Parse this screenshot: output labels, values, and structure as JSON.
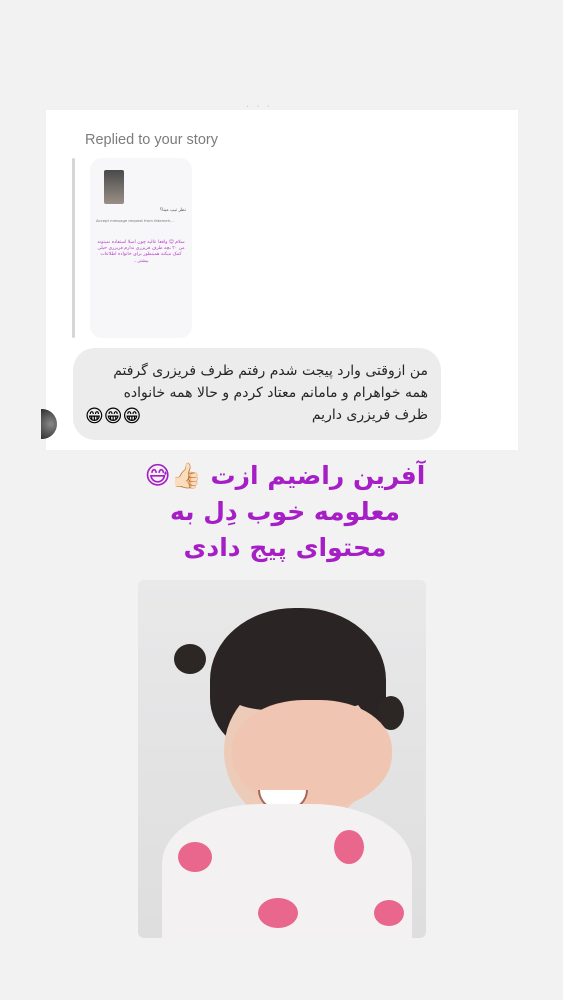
{
  "dm": {
    "replied_label": "Replied to your story",
    "story_preview": {
      "caption": "نظر تیپ مینا؟",
      "meta": "Accept message request from fatemeh...",
      "text": "سلام 😊 واقعا عالیه چون اصلا استفاده نمیتونه من ۲۰ بچه ظرف فریزری ندارم فریزری خیلی کمک میکنه همینطور برای خانواده اطلاعات بیشتر..."
    },
    "message": "من  ازوقتی وارد پیجت شدم رفتم ظرف فریزری گرفتم همه خواهرام و مامانم معتاد کردم و حالا همه خانواده ظرف فریزری داریم",
    "message_emojis": "😁😁😁"
  },
  "overlay": {
    "line1": "آفرین راضیم ازت 👍🏻😅",
    "line2": "معلومه خوب دِل به",
    "line3": "محتوای پیج دادی"
  },
  "colors": {
    "headline": "#a61fc6",
    "bubble": "#ececec",
    "background": "#f2f2f2"
  }
}
